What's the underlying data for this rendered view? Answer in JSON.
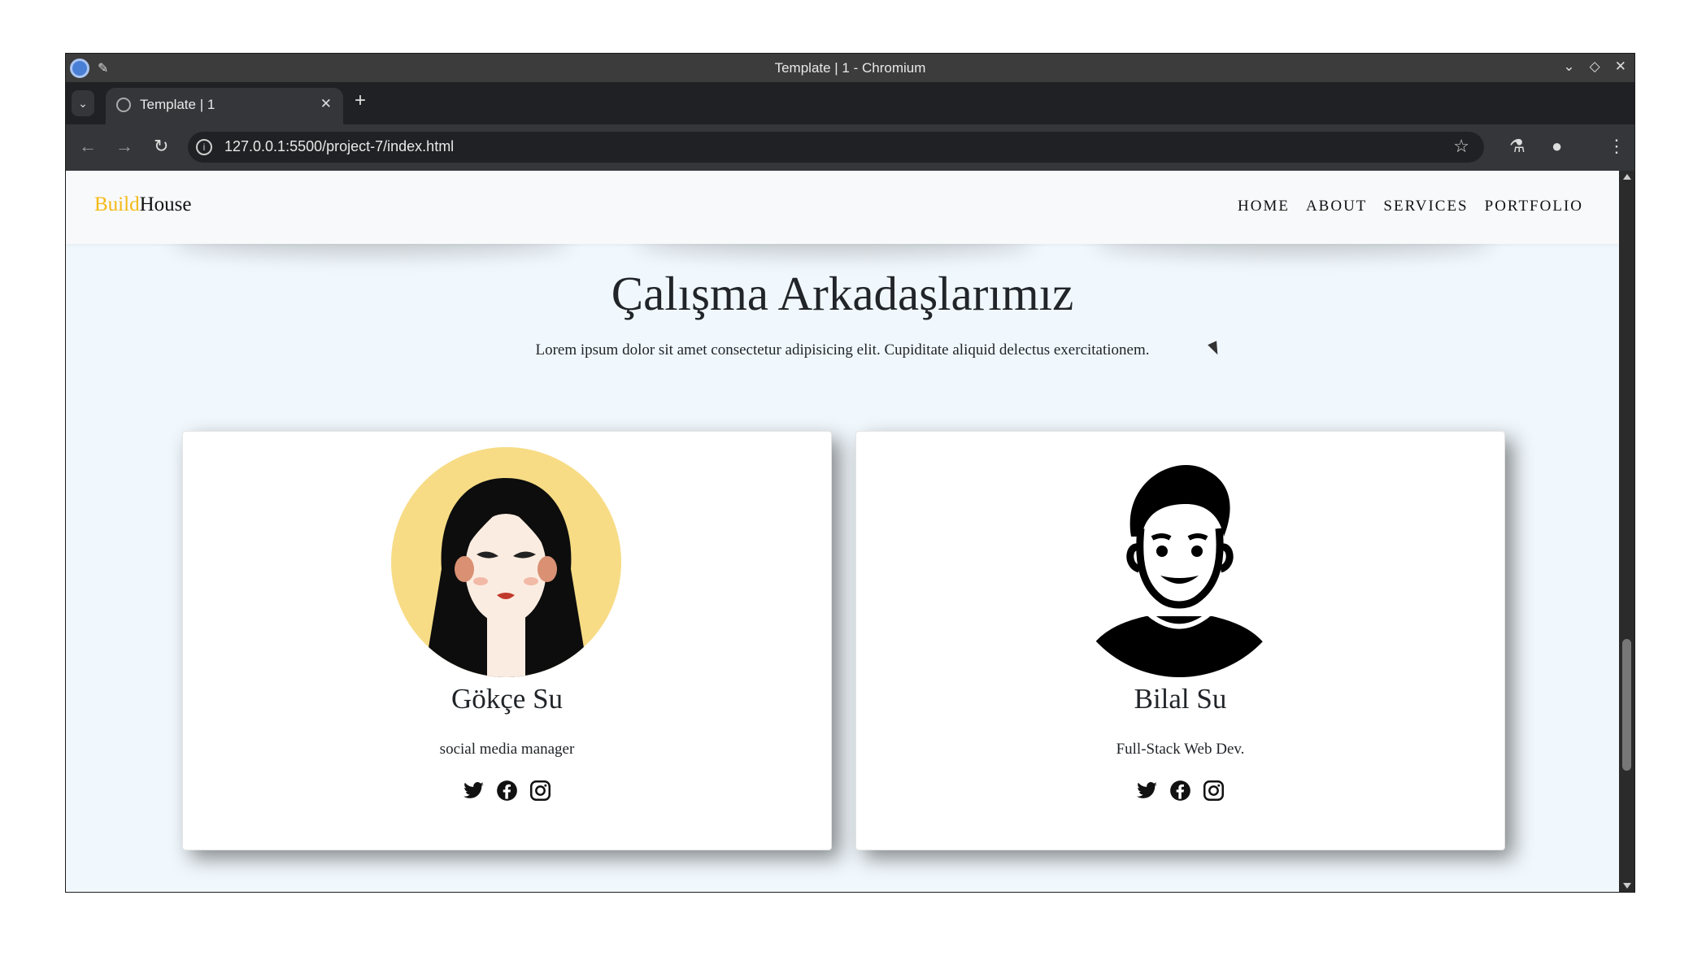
{
  "browser": {
    "window_title": "Template | 1 - Chromium",
    "tab_title": "Template | 1",
    "url": "127.0.0.1:5500/project-7/index.html"
  },
  "navbar": {
    "brand_part1": "Build",
    "brand_part2": "House",
    "brand_accent_color": "#f5b914",
    "links": [
      "HOME",
      "ABOUT",
      "SERVICES",
      "PORTFOLIO"
    ]
  },
  "section": {
    "title": "Çalışma Arkadaşlarımız",
    "subtitle": "Lorem ipsum dolor sit amet consectetur adipisicing elit. Cupiditate aliquid delectus exercitationem."
  },
  "team": [
    {
      "name": "Gökçe Su",
      "role": "social media manager",
      "avatar_icon": "woman-avatar-icon",
      "social_icons": [
        "twitter-icon",
        "facebook-icon",
        "instagram-icon"
      ]
    },
    {
      "name": "Bilal Su",
      "role": "Full-Stack Web Dev.",
      "avatar_icon": "man-avatar-icon",
      "social_icons": [
        "twitter-icon",
        "facebook-icon",
        "instagram-icon"
      ]
    }
  ]
}
